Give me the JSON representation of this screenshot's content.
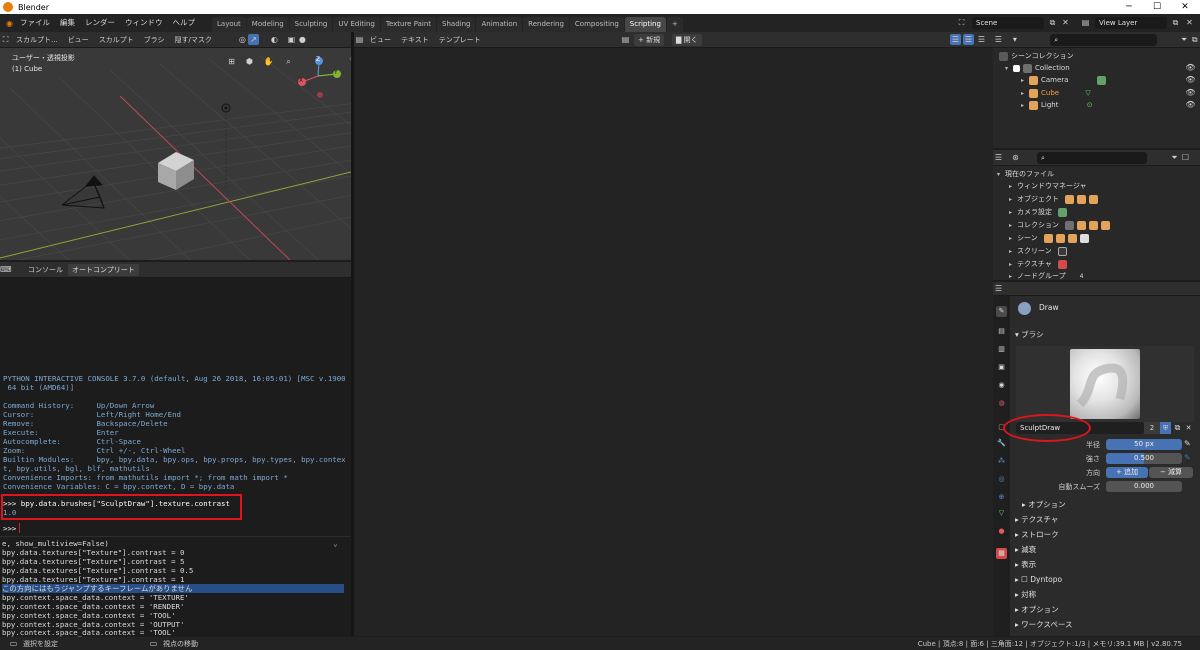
{
  "window": {
    "title": "Blender",
    "min": "─",
    "max": "☐",
    "close": "✕"
  },
  "menus": [
    "ファイル",
    "編集",
    "レンダー",
    "ウィンドウ",
    "ヘルプ"
  ],
  "workspaces": [
    "Layout",
    "Modeling",
    "Sculpting",
    "UV Editing",
    "Texture Paint",
    "Shading",
    "Animation",
    "Rendering",
    "Compositing",
    "Scripting"
  ],
  "active_workspace": "Scripting",
  "add_tab": "+",
  "scene": {
    "name": "Scene",
    "view_layer": "View Layer"
  },
  "viewport": {
    "mode": "スカルプト...",
    "menus": [
      "ビュー",
      "スカルプト",
      "ブラシ",
      "隠す/マスク"
    ],
    "overlay_title": "ユーザー・透視投影",
    "overlay_object": "(1) Cube",
    "gizmo_z": "Z",
    "gizmo_y": "Y",
    "gizmo_x": "X"
  },
  "console": {
    "tabs": [
      "コンソール",
      "オートコンプリート"
    ],
    "lines": [
      "PYTHON INTERACTIVE CONSOLE 3.7.0 (default, Aug 26 2018, 16:05:01) [MSC v.1900",
      " 64 bit (AMD64)]",
      "",
      "Command History:     Up/Down Arrow",
      "Cursor:              Left/Right Home/End",
      "Remove:              Backspace/Delete",
      "Execute:             Enter",
      "Autocomplete:        Ctrl-Space",
      "Zoom:                Ctrl +/-, Ctrl-Wheel",
      "Builtin Modules:     bpy, bpy.data, bpy.ops, bpy.props, bpy.types, bpy.contex",
      "t, bpy.utils, bgl, blf, mathutils",
      "Convenience Imports: from mathutils import *; from math import *",
      "Convenience Variables: C = bpy.context, D = bpy.data"
    ],
    "command": ">>> bpy.data.brushes[\"SculptDraw\"].texture.contrast",
    "result": "1.0",
    "prompt": ">>> "
  },
  "info": {
    "lines": [
      "e, show_multiview=False)",
      "bpy.data.textures[\"Texture\"].contrast = 0",
      "bpy.data.textures[\"Texture\"].contrast = 5",
      "bpy.data.textures[\"Texture\"].contrast = 0.5",
      "bpy.data.textures[\"Texture\"].contrast = 1",
      "この方向にはもうジャンプするキーフレームがありません",
      "bpy.context.space_data.context = 'TEXTURE'",
      "bpy.context.space_data.context = 'RENDER'",
      "bpy.context.space_data.context = 'TOOL'",
      "bpy.context.space_data.context = 'OUTPUT'",
      "bpy.context.space_data.context = 'TOOL'"
    ],
    "highlight_index": 5
  },
  "text_editor": {
    "menus": [
      "ビュー",
      "テキスト",
      "テンプレート"
    ],
    "new_label": "新規",
    "open_label": "開く"
  },
  "outliner": {
    "root": "シーンコレクション",
    "collection": "Collection",
    "objects": [
      {
        "name": "Camera",
        "color": "#e3a35a"
      },
      {
        "name": "Cube",
        "color": "#e3a35a"
      },
      {
        "name": "Light",
        "color": "#e3a35a"
      }
    ]
  },
  "file_view": {
    "root": "現在のファイル",
    "items": [
      "ウィンドウマネージャ",
      "オブジェクト",
      "カメラ設定",
      "コレクション",
      "シーン",
      "スクリーン",
      "テクスチャ",
      "ノードグループ"
    ],
    "node_group_count": "4"
  },
  "properties": {
    "brush_name": "Draw",
    "brush_panel": "ブラシ",
    "brush_datablock": "SculptDraw",
    "users": "2",
    "radius_label": "半径",
    "radius_value": "50 px",
    "strength_label": "強さ",
    "strength_value": "0.500",
    "strength_fraction": 0.5,
    "direction_label": "方向",
    "add_label": "追加",
    "subtract_label": "減算",
    "autosmooth_label": "自動スムーズ",
    "autosmooth_value": "0.000",
    "options_sub": "オプション",
    "panels": [
      "テクスチャ",
      "ストローク",
      "減衰",
      "表示",
      "Dyntopo",
      "対称",
      "オプション",
      "ワークスペース"
    ]
  },
  "status": {
    "left1": "選択を設定",
    "left2": "視点の移動",
    "right": "Cube | 頂点:8 | 面:6 | 三角面:12 | オブジェクト:1/3 | メモリ:39.1 MB | v2.80.75"
  }
}
